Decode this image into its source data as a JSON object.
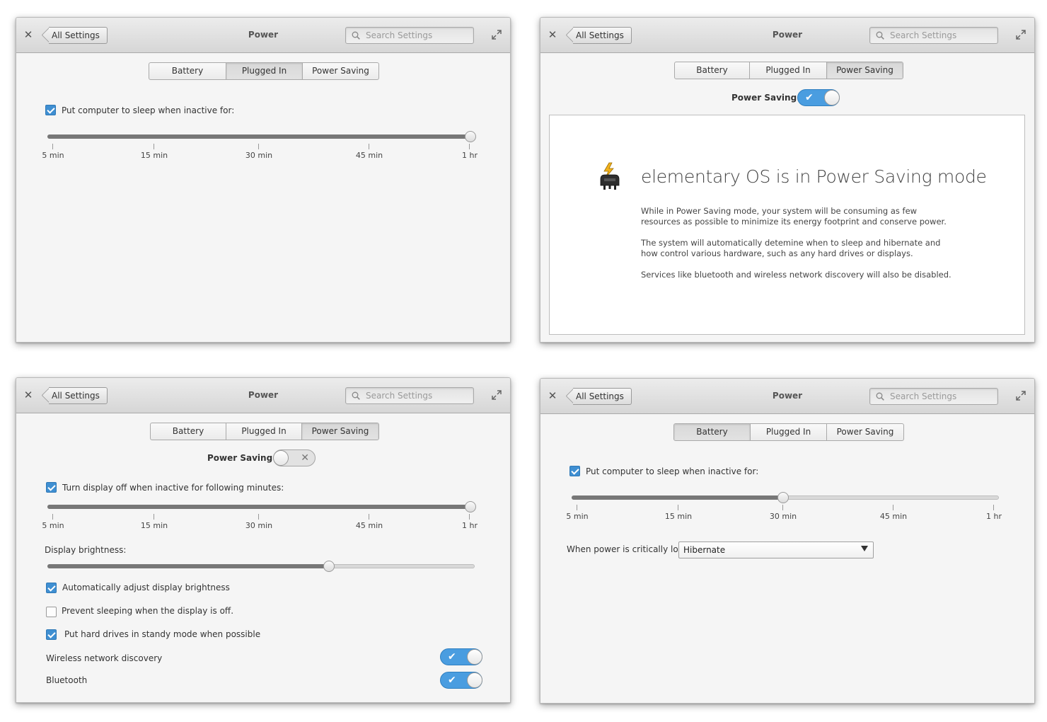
{
  "window": {
    "close_glyph": "✕",
    "back_label": "All Settings",
    "title": "Power",
    "search_placeholder": "Search Settings"
  },
  "tabs": [
    "Battery",
    "Plugged In",
    "Power Saving"
  ],
  "slider_ticks": [
    "5 min",
    "15 min",
    "30 min",
    "45 min",
    "1 hr"
  ],
  "panel_plugged_in": {
    "active_tab": "Plugged In",
    "sleep_checkbox_label": "Put computer to sleep when inactive for:",
    "sleep_checked": true,
    "sleep_slider_value": "1 hr",
    "sleep_slider_fraction": 1.0
  },
  "panel_power_saving_on": {
    "active_tab": "Power Saving",
    "toggle_label": "Power Saving",
    "toggle_on": true,
    "heading": "elementary OS is in Power Saving mode",
    "paragraphs": [
      "While in Power Saving mode, your system will be consuming as few resources as possible to minimize its energy footprint and conserve power.",
      "The system will automatically detemine when to sleep and hibernate and how control various hardware, such as any hard drives or displays.",
      "Services like bluetooth and wireless network discovery will also be disabled."
    ],
    "icon": "power-saving-plug-icon"
  },
  "panel_power_saving_off": {
    "active_tab": "Power Saving",
    "toggle_label": "Power Saving",
    "toggle_on": false,
    "display_off_label": "Turn display off when inactive for following minutes:",
    "display_off_checked": true,
    "display_off_fraction": 1.0,
    "brightness_label": "Display brightness:",
    "brightness_fraction": 0.66,
    "auto_brightness_label": "Automatically adjust display brightness",
    "auto_brightness_checked": true,
    "prevent_sleep_label": "Prevent sleeping when the display is off.",
    "prevent_sleep_checked": false,
    "standby_label": "Put hard drives in standy mode when possible",
    "standby_checked": true,
    "wireless_label": "Wireless network discovery",
    "wireless_on": true,
    "bluetooth_label": "Bluetooth",
    "bluetooth_on": true
  },
  "panel_battery": {
    "active_tab": "Battery",
    "sleep_checkbox_label": "Put computer to sleep when inactive for:",
    "sleep_checked": true,
    "sleep_slider_value": "30 min",
    "sleep_slider_fraction": 0.49,
    "critical_label": "When power is critically low:",
    "critical_value": "Hibernate"
  }
}
